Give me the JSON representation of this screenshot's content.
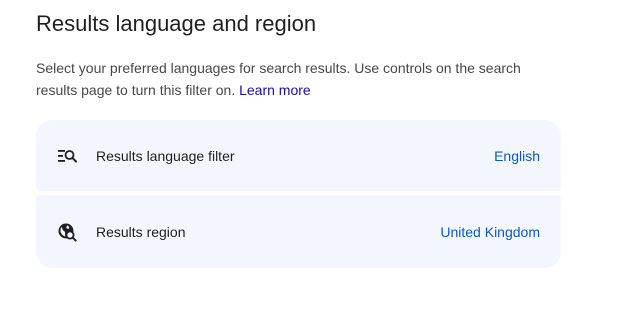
{
  "section": {
    "title": "Results language and region",
    "description": "Select your preferred languages for search results. Use controls on the search results page to turn this filter on.",
    "learn_more": "Learn more"
  },
  "settings": [
    {
      "label": "Results language filter",
      "value": "English",
      "icon": "language-filter-icon"
    },
    {
      "label": "Results region",
      "value": "United Kingdom",
      "icon": "globe-search-icon"
    }
  ],
  "colors": {
    "card_bg": "#f3f6fc",
    "link": "#1a0dab",
    "value": "#0b57d0",
    "text": "#1f1f1f",
    "muted": "#474747"
  }
}
